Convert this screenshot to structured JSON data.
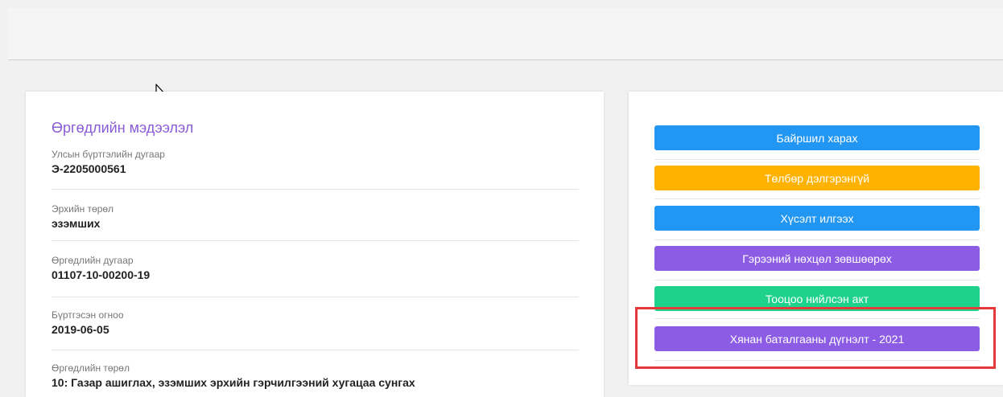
{
  "info": {
    "title": "Өргөдлийн мэдээлэл",
    "fields": [
      {
        "label": "Улсын бүртгэлийн дугаар",
        "value": "Э-2205000561"
      },
      {
        "label": "Эрхийн төрөл",
        "value": "эзэмших"
      },
      {
        "label": "Өргөдлийн дугаар",
        "value": "01107-10-00200-19"
      },
      {
        "label": "Бүртгэсэн огноо",
        "value": "2019-06-05"
      },
      {
        "label": "Өргөдлийн төрөл",
        "value": "10: Газар ашиглах, эзэмших эрхийн гэрчилгээний хугацаа сунгах"
      }
    ]
  },
  "actions": [
    {
      "label": "Байршил харах",
      "color": "#2296f3"
    },
    {
      "label": "Төлбөр дэлгэрэнгүй",
      "color": "#ffb300"
    },
    {
      "label": "Хүсэлт илгээх",
      "color": "#2296f3"
    },
    {
      "label": "Гэрээний нөхцөл зөвшөөрөх",
      "color": "#8c5de4"
    },
    {
      "label": "Тооцоо нийлсэн акт",
      "color": "#1fd28c"
    },
    {
      "label": "Хянан баталгааны дүгнэлт - 2021",
      "color": "#8c5de4"
    }
  ],
  "highlight_color": "#e5383b"
}
